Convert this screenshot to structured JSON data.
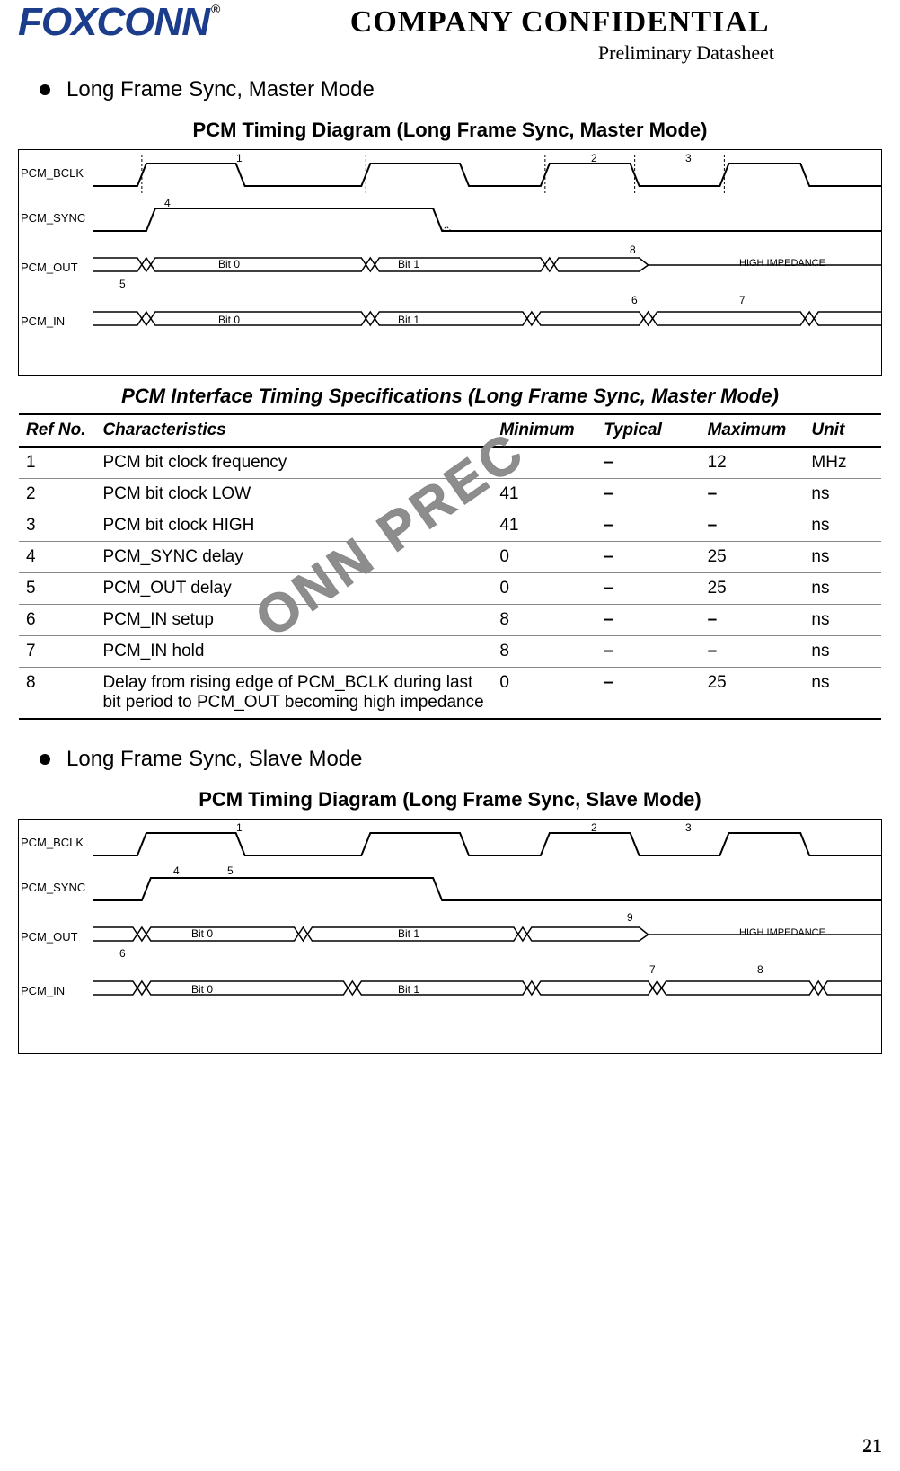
{
  "header": {
    "logo_text": "FOXCONN",
    "logo_reg": "®",
    "confidential": "COMPANY  CONFIDENTIAL",
    "preliminary": "Preliminary  Datasheet"
  },
  "sections": {
    "master_bullet": "Long Frame Sync, Master Mode",
    "slave_bullet": "Long Frame Sync, Slave Mode"
  },
  "diagram_master": {
    "title": "PCM Timing Diagram (Long Frame Sync, Master Mode)",
    "signals": {
      "bclk": "PCM_BCLK",
      "sync": "PCM_SYNC",
      "out": "PCM_OUT",
      "in": "PCM_IN"
    },
    "labels": {
      "bit0": "Bit 0",
      "bit1": "Bit 1",
      "hiz": "HIGH IMPEDANCE"
    },
    "markers": {
      "m1": "1",
      "m2": "2",
      "m3": "3",
      "m4": "4",
      "m5": "5",
      "m6": "6",
      "m7": "7",
      "m8": "8"
    }
  },
  "spec_table": {
    "title": "PCM Interface Timing Specifications (Long Frame Sync, Master Mode)",
    "headers": {
      "ref": "Ref No.",
      "char": "Characteristics",
      "min": "Minimum",
      "typ": "Typical",
      "max": "Maximum",
      "unit": "Unit"
    },
    "rows": [
      {
        "ref": "1",
        "char": "PCM bit clock frequency",
        "min": "",
        "typ": "–",
        "max": "12",
        "unit": "MHz"
      },
      {
        "ref": "2",
        "char": "PCM bit clock LOW",
        "min": "41",
        "typ": "–",
        "max": "–",
        "unit": "ns"
      },
      {
        "ref": "3",
        "char": "PCM bit clock HIGH",
        "min": "41",
        "typ": "–",
        "max": "–",
        "unit": "ns"
      },
      {
        "ref": "4",
        "char": "PCM_SYNC delay",
        "min": "0",
        "typ": "–",
        "max": "25",
        "unit": "ns"
      },
      {
        "ref": "5",
        "char": "PCM_OUT delay",
        "min": "0",
        "typ": "–",
        "max": "25",
        "unit": "ns"
      },
      {
        "ref": "6",
        "char": "PCM_IN setup",
        "min": "8",
        "typ": "–",
        "max": "–",
        "unit": "ns"
      },
      {
        "ref": "7",
        "char": "PCM_IN hold",
        "min": "8",
        "typ": "–",
        "max": "–",
        "unit": "ns"
      },
      {
        "ref": "8",
        "char": "Delay from rising edge of PCM_BCLK during last bit period to PCM_OUT becoming high impedance",
        "min": "0",
        "typ": "–",
        "max": "25",
        "unit": "ns"
      }
    ]
  },
  "diagram_slave": {
    "title": "PCM Timing Diagram (Long Frame Sync, Slave Mode)",
    "signals": {
      "bclk": "PCM_BCLK",
      "sync": "PCM_SYNC",
      "out": "PCM_OUT",
      "in": "PCM_IN"
    },
    "labels": {
      "bit0": "Bit 0",
      "bit1": "Bit 1",
      "hiz": "HIGH IMPEDANCE"
    },
    "markers": {
      "m1": "1",
      "m2": "2",
      "m3": "3",
      "m4": "4",
      "m5": "5",
      "m6": "6",
      "m7": "7",
      "m8": "8",
      "m9": "9"
    }
  },
  "watermark": "ONN PREC",
  "page_number": "21",
  "chart_data": [
    {
      "type": "table",
      "title": "PCM Interface Timing Specifications (Long Frame Sync, Master Mode)",
      "columns": [
        "Ref No.",
        "Characteristics",
        "Minimum",
        "Typical",
        "Maximum",
        "Unit"
      ],
      "rows": [
        [
          "1",
          "PCM bit clock frequency",
          null,
          null,
          12,
          "MHz"
        ],
        [
          "2",
          "PCM bit clock LOW",
          41,
          null,
          null,
          "ns"
        ],
        [
          "3",
          "PCM bit clock HIGH",
          41,
          null,
          null,
          "ns"
        ],
        [
          "4",
          "PCM_SYNC delay",
          0,
          null,
          25,
          "ns"
        ],
        [
          "5",
          "PCM_OUT delay",
          0,
          null,
          25,
          "ns"
        ],
        [
          "6",
          "PCM_IN setup",
          8,
          null,
          null,
          "ns"
        ],
        [
          "7",
          "PCM_IN hold",
          8,
          null,
          null,
          "ns"
        ],
        [
          "8",
          "Delay from rising edge of PCM_BCLK during last bit period to PCM_OUT becoming high impedance",
          0,
          null,
          25,
          "ns"
        ]
      ]
    }
  ]
}
